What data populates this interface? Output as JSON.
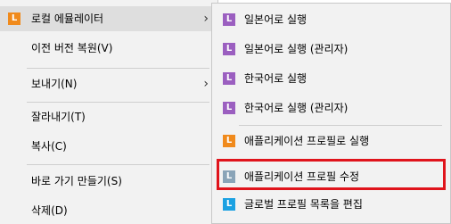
{
  "colors": {
    "menu_bg": "#f2f2f2",
    "highlight_bg": "#dedede",
    "icon_orange": "#f08a1c",
    "icon_purple": "#9b5fc0",
    "icon_gray": "#8aa4b8",
    "icon_blue": "#1ba1e2",
    "callout_red": "#e0141c"
  },
  "left_menu": {
    "items": [
      {
        "label": "로컬 에뮬레이터",
        "icon": "L",
        "has_submenu": true
      },
      {
        "label": "이전 버전 복원(V)"
      },
      {
        "label": "보내기(N)",
        "has_submenu": true
      },
      {
        "label": "잘라내기(T)"
      },
      {
        "label": "복사(C)"
      },
      {
        "label": "바로 가기 만들기(S)"
      },
      {
        "label": "삭제(D)"
      }
    ],
    "arrow": "›"
  },
  "submenu": {
    "items": [
      {
        "label": "일본어로 실행",
        "icon": "L"
      },
      {
        "label": "일본어로 실행 (관리자)",
        "icon": "L"
      },
      {
        "label": "한국어로 실행",
        "icon": "L"
      },
      {
        "label": "한국어로 실행 (관리자)",
        "icon": "L"
      },
      {
        "label": "애플리케이션 프로필로 실행",
        "icon": "L"
      },
      {
        "label": "애플리케이션 프로필 수정",
        "icon": "L"
      },
      {
        "label": "글로벌 프로필 목록을 편집",
        "icon": "L"
      }
    ]
  }
}
